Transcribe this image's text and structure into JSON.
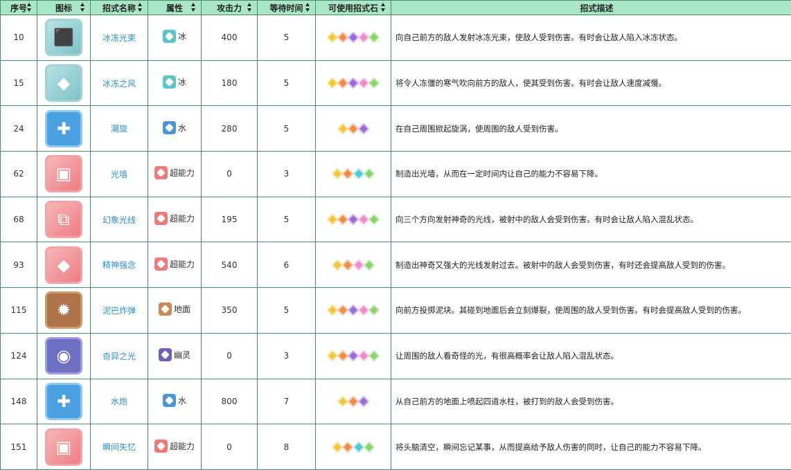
{
  "headers": [
    "序号",
    "图标",
    "招式名称",
    "属性",
    "攻击力",
    "等待时间",
    "可使用招式石",
    "招式描述"
  ],
  "colors": {
    "header_bg": "#a8e6c6",
    "name_text": "#2f8fd0",
    "border": "#4a8a6a"
  },
  "rows": [
    {
      "id": "10",
      "icon": "ice-beam-icon",
      "icon_style": "ice",
      "glyph": "⬛",
      "name": "冰冻光束",
      "type": "冰",
      "type_style": "ice",
      "power": "400",
      "wait": "5",
      "stones": [
        "yellow",
        "orange",
        "purple",
        "pink",
        "green"
      ],
      "desc": "向自己前方的敌人发射冰冻光束，使敌人受到伤害。有时会让敌人陷入冰冻状态。"
    },
    {
      "id": "15",
      "icon": "icy-wind-icon",
      "icon_style": "ice",
      "glyph": "◆",
      "name": "冰冻之风",
      "type": "冰",
      "type_style": "ice",
      "power": "180",
      "wait": "5",
      "stones": [
        "yellow",
        "orange",
        "purple",
        "pink",
        "green"
      ],
      "desc": "将令人冻僵的寒气吹向前方的敌人，使其受到伤害。有时会让敌人速度减慢。"
    },
    {
      "id": "24",
      "icon": "whirlpool-icon",
      "icon_style": "water",
      "glyph": "✚",
      "name": "潮旋",
      "type": "水",
      "type_style": "water",
      "power": "280",
      "wait": "5",
      "stones": [
        "yellow",
        "orange",
        "purple"
      ],
      "desc": "在自己周围掀起旋涡，使周围的敌人受到伤害。"
    },
    {
      "id": "62",
      "icon": "light-screen-icon",
      "icon_style": "psy",
      "glyph": "▣",
      "name": "光墙",
      "type": "超能力",
      "type_style": "psy",
      "power": "0",
      "wait": "3",
      "stones": [
        "yellow",
        "orange",
        "cyan",
        "green"
      ],
      "desc": "制造出光墙，从而在一定时间内让自己的能力不容易下降。"
    },
    {
      "id": "68",
      "icon": "psybeam-icon",
      "icon_style": "psy",
      "glyph": "⧉",
      "name": "幻象光线",
      "type": "超能力",
      "type_style": "psy",
      "power": "195",
      "wait": "5",
      "stones": [
        "yellow",
        "orange",
        "purple",
        "pink",
        "green"
      ],
      "desc": "向三个方向发射神奇的光线，被射中的敌人会受到伤害。有时会让敌人陷入混乱状态。"
    },
    {
      "id": "93",
      "icon": "psychic-icon",
      "icon_style": "psy",
      "glyph": "◆",
      "name": "精神强念",
      "type": "超能力",
      "type_style": "psy",
      "power": "540",
      "wait": "6",
      "stones": [
        "yellow",
        "orange",
        "pink",
        "green"
      ],
      "desc": "制造出神奇又强大的光线发射过去。被射中的敌人会受到伤害，有时还会提高敌人受到的伤害。"
    },
    {
      "id": "115",
      "icon": "mud-bomb-icon",
      "icon_style": "ground",
      "glyph": "✹",
      "name": "泥巴炸弹",
      "type": "地面",
      "type_style": "ground",
      "power": "350",
      "wait": "5",
      "stones": [
        "yellow",
        "orange",
        "purple",
        "pink",
        "green"
      ],
      "desc": "向前方投掷泥块。其碰到地面后会立刻爆裂，使周围的敌人受到伤害。有时会提高敌人受到的伤害。"
    },
    {
      "id": "124",
      "icon": "confuse-ray-icon",
      "icon_style": "ghost",
      "glyph": "◉",
      "name": "奇异之光",
      "type": "幽灵",
      "type_style": "ghost",
      "power": "0",
      "wait": "3",
      "stones": [
        "yellow",
        "orange",
        "purple",
        "pink",
        "green"
      ],
      "desc": "让周围的敌人看奇怪的光，有很高概率会让敌人陷入混乱状态。"
    },
    {
      "id": "148",
      "icon": "water-spout-icon",
      "icon_style": "water",
      "glyph": "✚",
      "name": "水炮",
      "type": "水",
      "type_style": "water",
      "power": "800",
      "wait": "7",
      "stones": [
        "yellow",
        "orange",
        "purple"
      ],
      "desc": "从自己前方的地面上喷起四道水柱，被打到的敌人会受到伤害。"
    },
    {
      "id": "151",
      "icon": "amnesia-icon",
      "icon_style": "psy",
      "glyph": "▣",
      "name": "瞬间失忆",
      "type": "超能力",
      "type_style": "psy",
      "power": "0",
      "wait": "8",
      "stones": [
        "yellow",
        "orange",
        "cyan",
        "green"
      ],
      "desc": "将头脑清空，瞬间忘记某事，从而提高给予敌人伤害的同时，让自己的能力不容易下降。"
    }
  ]
}
